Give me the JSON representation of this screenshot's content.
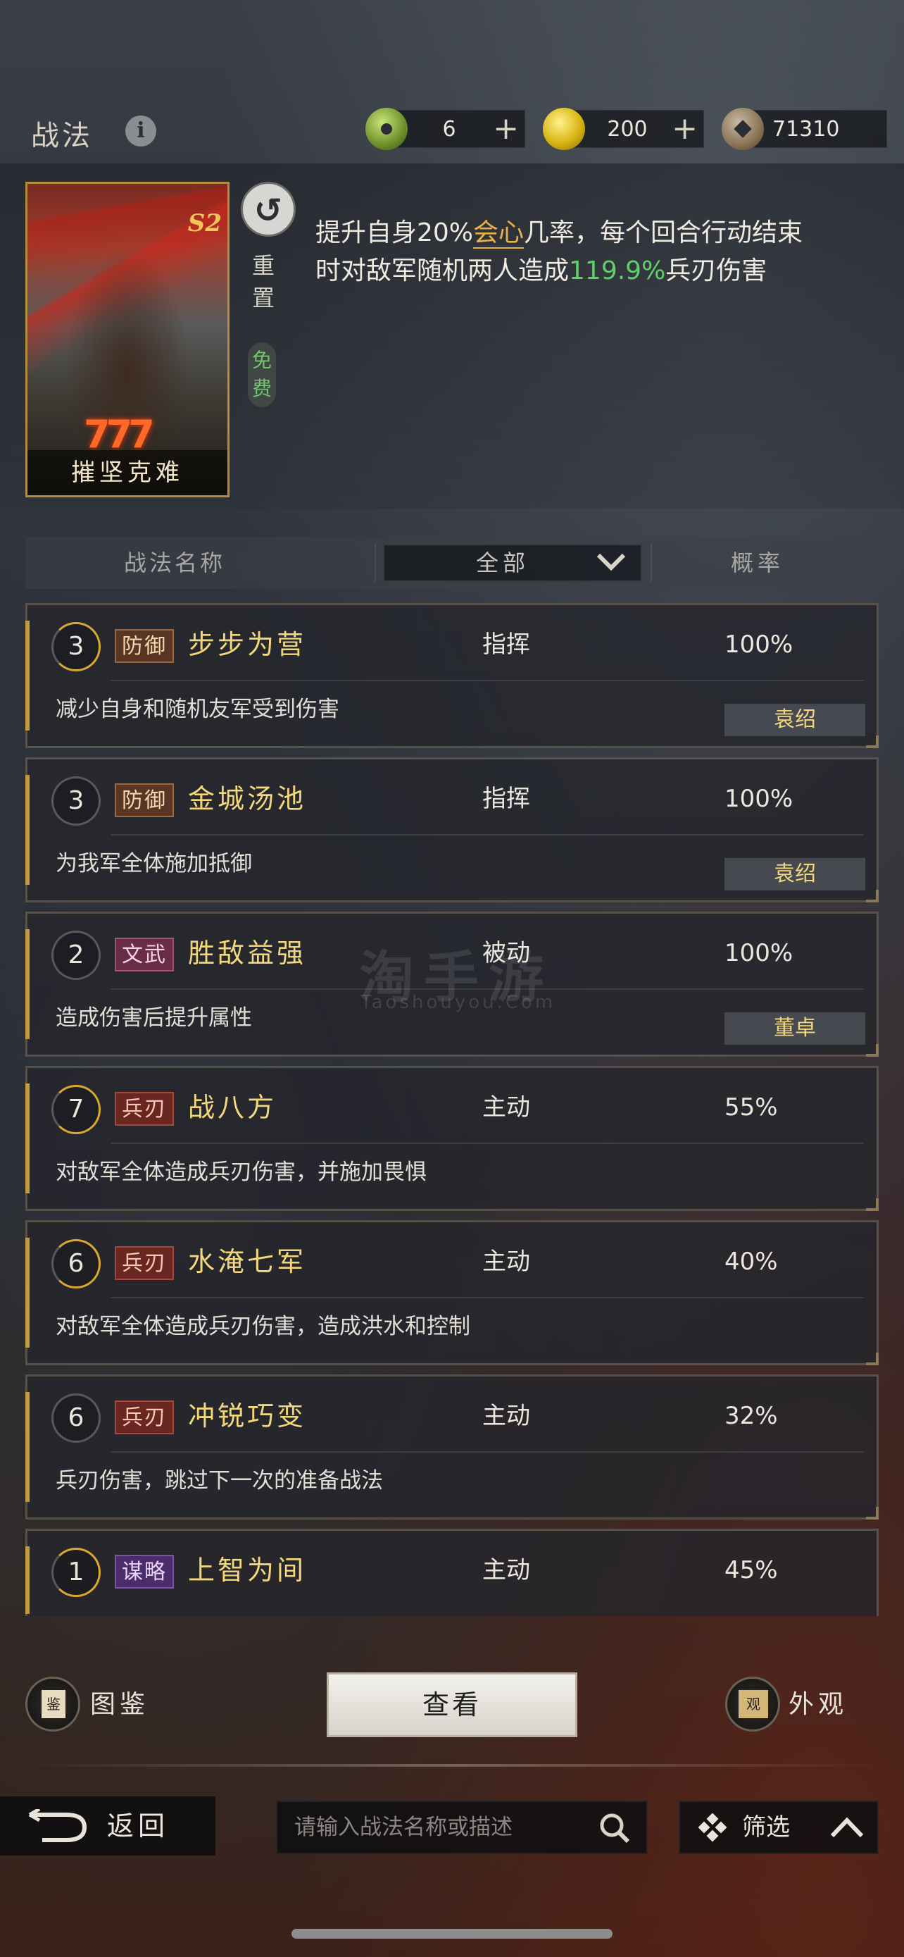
{
  "header": {
    "title": "战法",
    "currencies": [
      {
        "name": "jade",
        "value": "6"
      },
      {
        "name": "gold",
        "value": "200"
      },
      {
        "name": "copper",
        "value": "71310"
      }
    ]
  },
  "selected": {
    "card_name": "摧坚克难",
    "card_badge": "S2",
    "card_marks": "777",
    "reset_label": "重置",
    "free_label": "免费",
    "desc_prefix": "提升自身20%",
    "desc_hl1": "会心",
    "desc_mid": "几率，每个回合行动结束时对敌军随机两人造成",
    "desc_hl2": "119.9%",
    "desc_suffix": "兵刃伤害"
  },
  "columns": {
    "name": "战法名称",
    "filter": "全部",
    "rate": "概率"
  },
  "skills": [
    {
      "level": "3",
      "tag": "防御",
      "name": "步步为营",
      "type": "指挥",
      "rate": "100%",
      "desc": "减少自身和随机友军受到伤害",
      "owner": "袁绍"
    },
    {
      "level": "3",
      "tag": "防御",
      "name": "金城汤池",
      "type": "指挥",
      "rate": "100%",
      "desc": "为我军全体施加抵御",
      "owner": "袁绍"
    },
    {
      "level": "2",
      "tag": "文武",
      "name": "胜敌益强",
      "type": "被动",
      "rate": "100%",
      "desc": "造成伤害后提升属性",
      "owner": "董卓"
    },
    {
      "level": "7",
      "tag": "兵刃",
      "name": "战八方",
      "type": "主动",
      "rate": "55%",
      "desc": "对敌军全体造成兵刃伤害，并施加畏惧",
      "owner": ""
    },
    {
      "level": "6",
      "tag": "兵刃",
      "name": "水淹七军",
      "type": "主动",
      "rate": "40%",
      "desc": "对敌军全体造成兵刃伤害，造成洪水和控制",
      "owner": ""
    },
    {
      "level": "6",
      "tag": "兵刃",
      "name": "冲锐巧变",
      "type": "主动",
      "rate": "32%",
      "desc": "兵刃伤害，跳过下一次的准备战法",
      "owner": ""
    },
    {
      "level": "1",
      "tag": "谋略",
      "name": "上智为间",
      "type": "主动",
      "rate": "45%",
      "desc": "",
      "owner": ""
    }
  ],
  "watermark": {
    "main": "淘手游",
    "sub": "Taoshouyou.Com"
  },
  "actions": {
    "codex": "图鉴",
    "codex_icon_text": "鉴",
    "view": "查看",
    "appearance": "外观",
    "appearance_icon_text": "观"
  },
  "footer": {
    "back": "返回",
    "search_placeholder": "请输入战法名称或描述",
    "filter": "筛选"
  }
}
